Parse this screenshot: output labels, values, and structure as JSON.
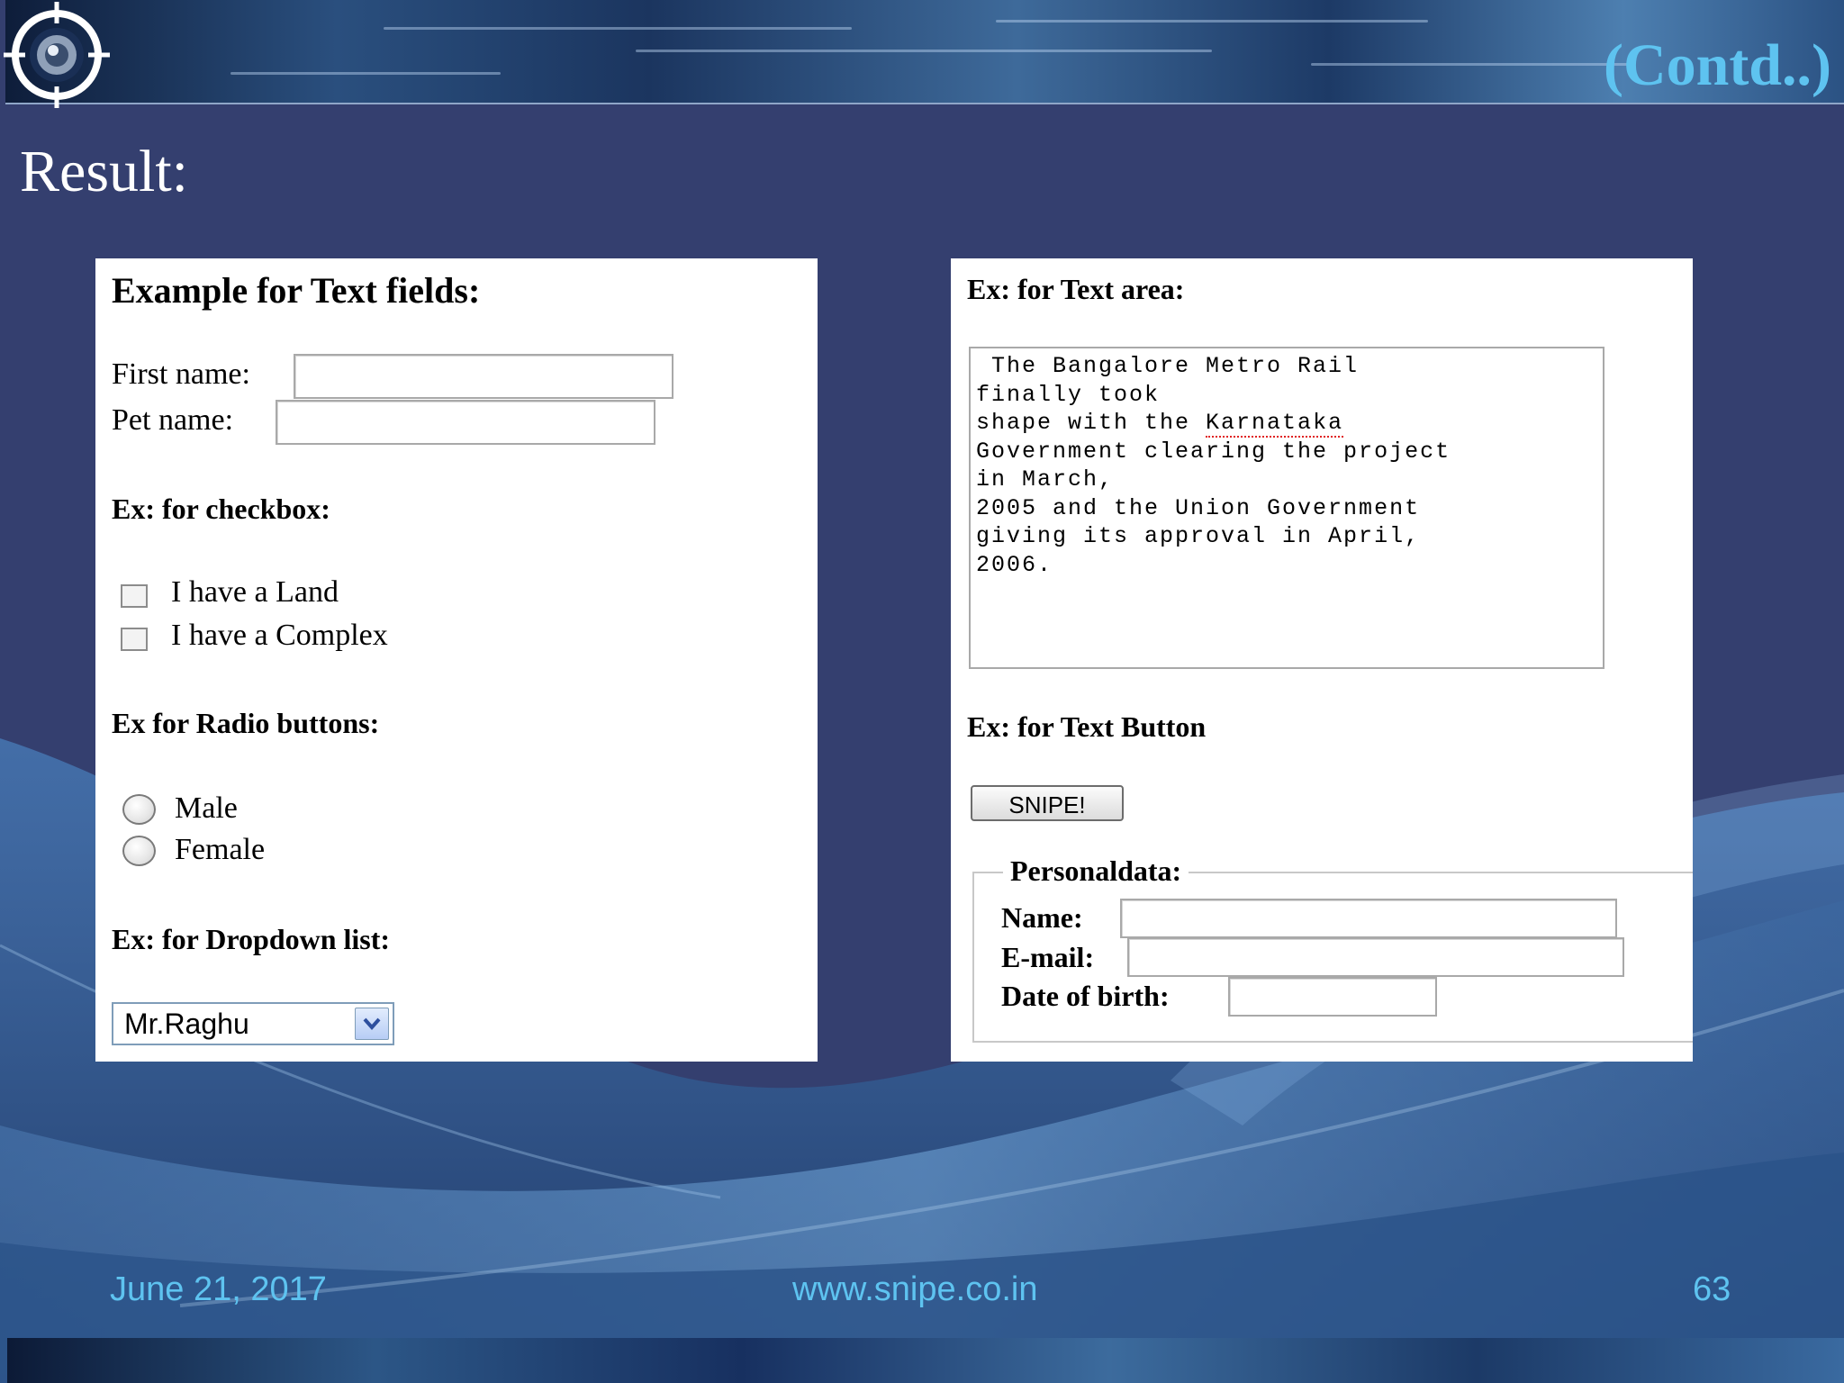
{
  "slide": {
    "contd": "(Contd..)",
    "result_title": "Result:"
  },
  "left_panel": {
    "text_fields_heading": "Example for Text fields:",
    "first_name_label": "First name:",
    "pet_name_label": "Pet name:",
    "checkbox_heading": "Ex: for checkbox:",
    "checkbox_land": "I have a Land",
    "checkbox_complex": "I have a Complex",
    "radio_heading": "Ex for Radio buttons:",
    "radio_male": "Male",
    "radio_female": "Female",
    "dropdown_heading": "Ex: for Dropdown list:",
    "dropdown_selected": "Mr.Raghu"
  },
  "right_panel": {
    "textarea_heading": "Ex: for Text area:",
    "textarea_lines": [
      " The Bangalore Metro Rail",
      "finally took",
      "shape with the ",
      "Government clearing the project",
      "in March,",
      "2005 and the Union Government",
      "giving its approval in April,",
      "2006."
    ],
    "textarea_misspelled": "Karnataka",
    "button_heading": "Ex: for Text Button",
    "button_label": "SNIPE!",
    "fieldset_legend": "Personaldata:",
    "name_label": "Name:",
    "email_label": "E-mail:",
    "dob_label": "Date of birth:"
  },
  "footer": {
    "date": "June 21, 2017",
    "website": "www.snipe.co.in",
    "page_number": "63"
  },
  "colors": {
    "background": "#343f6f",
    "accent_text": "#5ec3f0",
    "panel": "#ffffff"
  },
  "icons": {
    "logo": "crosshair-target-icon",
    "dropdown": "chevron-down-icon"
  }
}
